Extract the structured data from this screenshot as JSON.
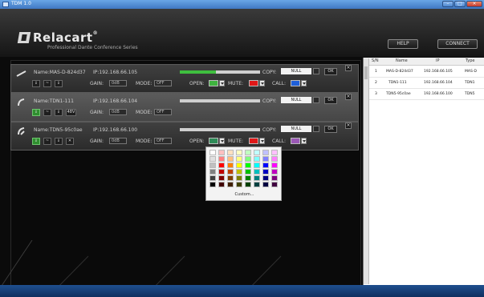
{
  "window": {
    "title": "TDM 1.0"
  },
  "brand": {
    "name": "Relacart",
    "reg": "®",
    "tagline": "Professional Dante Conference Series"
  },
  "header_buttons": {
    "help": "HELP",
    "connect": "CONNECT"
  },
  "devices": [
    {
      "name": "Name:MAS-D-824d37",
      "ip": "IP:192.168.66.105",
      "level_pct": 0.45,
      "copy_label": "COPY:",
      "copy_value": "NULL",
      "ok": "OK",
      "close": "×",
      "gain_label": "GAIN:",
      "gain_value": "0dB",
      "mode_label": "MODE:",
      "mode_value": "OFF",
      "open_label": "OPEN:",
      "open_color": "#3fb23f",
      "mute_label": "MUTE:",
      "mute_color": "#e01818",
      "call_label": "CALL:",
      "call_color": "#1f5fd8",
      "buttons": [
        "⇓",
        "~",
        "⇓"
      ]
    },
    {
      "name": "Name:TDN1-111",
      "ip": "IP:192.168.66.104",
      "level_pct": 0.0,
      "copy_label": "COPY:",
      "copy_value": "NULL",
      "ok": "OK",
      "close": "×",
      "gain_label": "GAIN:",
      "gain_value": "0dB",
      "mode_label": "MODE:",
      "mode_value": "OFF",
      "buttons": [
        "⇓",
        "~",
        "⇓",
        "48V"
      ]
    },
    {
      "name": "Name:TDN5-95c0ae",
      "ip": "IP:192.168.66.100",
      "level_pct": 0.0,
      "copy_label": "COPY:",
      "copy_value": "NULL",
      "ok": "OK",
      "close": "×",
      "gain_label": "GAIN:",
      "gain_value": "0dB",
      "mode_label": "MODE:",
      "mode_value": "OFF",
      "open_label": "OPEN:",
      "open_color": "#2e8b57",
      "mute_label": "MUTE:",
      "mute_color": "#e01818",
      "call_label": "CALL:",
      "call_color": "#9b59b6",
      "buttons": [
        "⇓",
        "~",
        "⇓",
        "✕"
      ]
    }
  ],
  "color_picker": {
    "custom_label": "Custom...",
    "colors": [
      [
        "#ffffff",
        "#ffc0c0",
        "#ffe0c0",
        "#ffffc0",
        "#c0ffc0",
        "#c0ffff",
        "#c0c0ff",
        "#ffc0ff"
      ],
      [
        "#e0e0e0",
        "#ff8080",
        "#ffc080",
        "#ffff80",
        "#80ff80",
        "#80ffff",
        "#8080ff",
        "#ff80ff"
      ],
      [
        "#c0c0c0",
        "#ff0000",
        "#ff8000",
        "#ffff00",
        "#00ff00",
        "#00ffff",
        "#0000ff",
        "#ff00ff"
      ],
      [
        "#808080",
        "#c00000",
        "#c04000",
        "#c0c000",
        "#00c000",
        "#00c0c0",
        "#0000c0",
        "#c000c0"
      ],
      [
        "#404040",
        "#800000",
        "#804000",
        "#808000",
        "#008000",
        "#008080",
        "#000080",
        "#800080"
      ],
      [
        "#000000",
        "#400000",
        "#402000",
        "#404000",
        "#004000",
        "#004040",
        "#000040",
        "#400040"
      ]
    ]
  },
  "device_list": {
    "columns": [
      "S/N",
      "Name",
      "IP",
      "Type"
    ],
    "rows": [
      [
        "1",
        "MAS-D-824d37",
        "192.168.66.105",
        "MAS-D"
      ],
      [
        "2",
        "TDN1-111",
        "192.168.66.104",
        "TDN1"
      ],
      [
        "3",
        "TDN5-95c0ae",
        "192.168.66.100",
        "TDN5"
      ]
    ]
  }
}
